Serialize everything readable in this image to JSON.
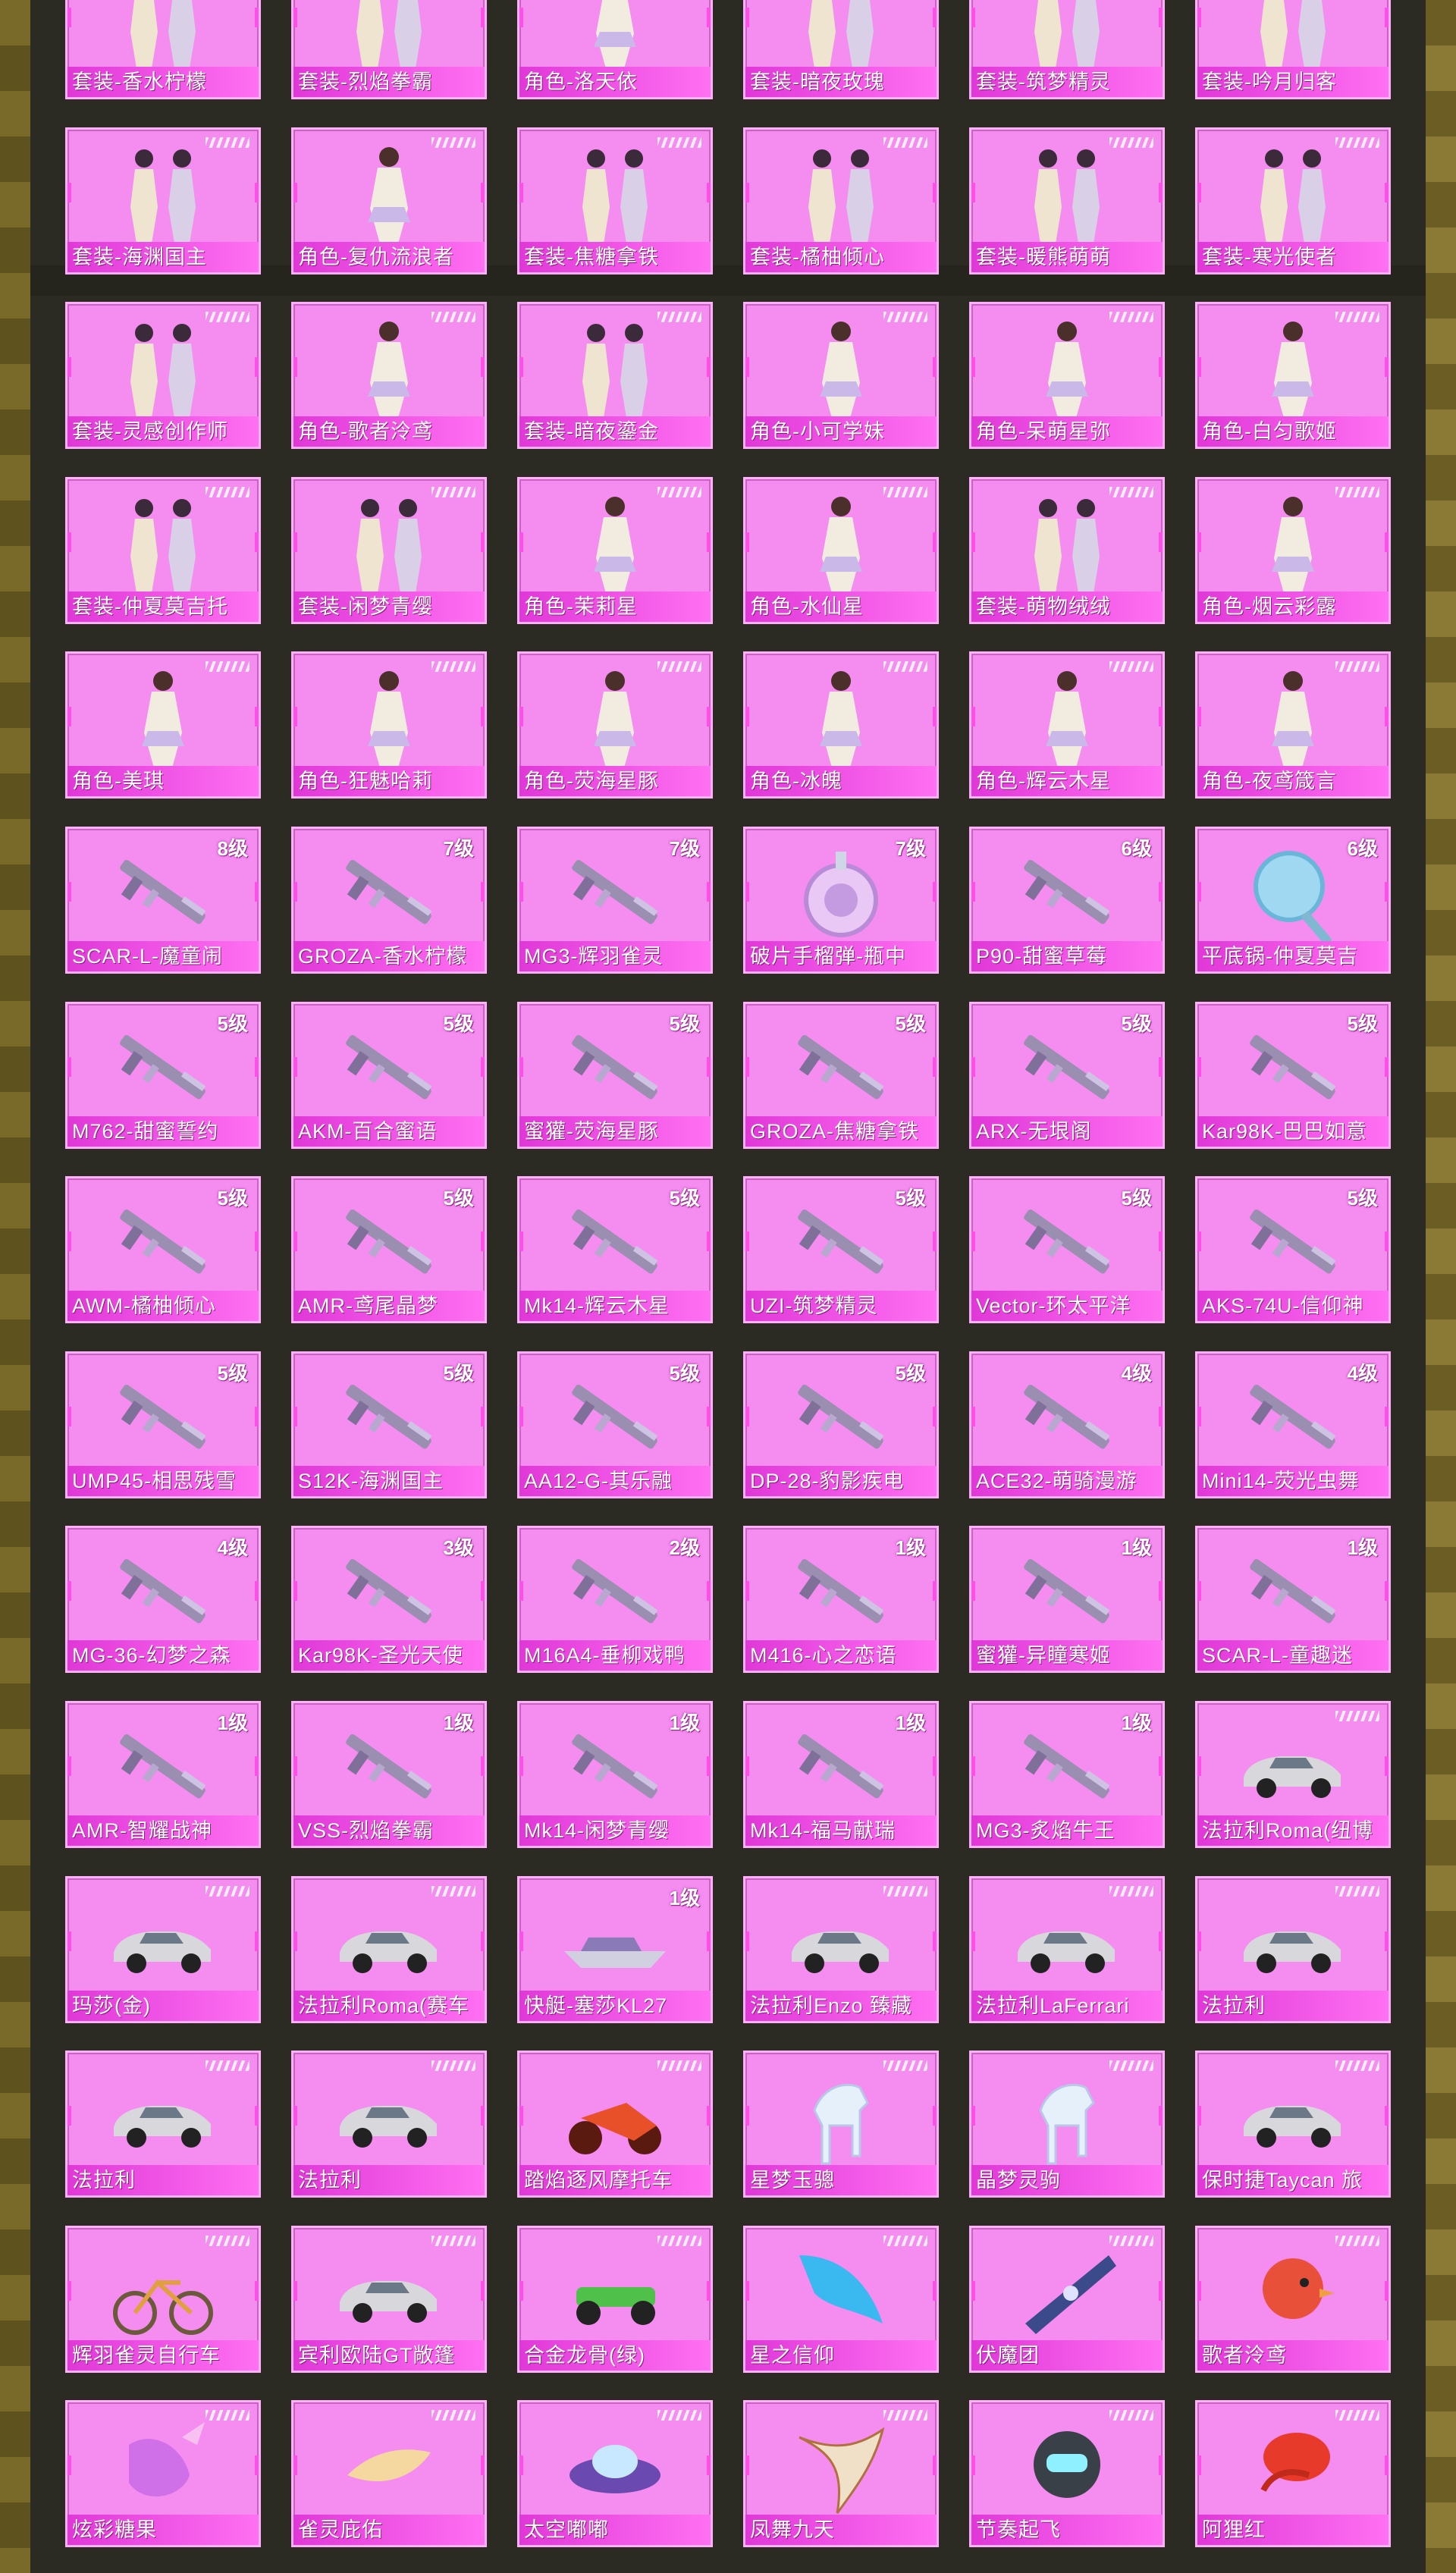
{
  "rows": [
    [
      {
        "label": "套装-香水柠檬",
        "art": "outfit-icon"
      },
      {
        "label": "套装-烈焰拳霸",
        "art": "outfit-icon"
      },
      {
        "label": "角色-洛天依",
        "art": "character-icon"
      },
      {
        "label": "套装-暗夜玫瑰",
        "art": "outfit-icon"
      },
      {
        "label": "套装-筑梦精灵",
        "art": "outfit-icon"
      },
      {
        "label": "套装-吟月归客",
        "art": "outfit-icon"
      }
    ],
    [
      {
        "label": "套装-海渊国主",
        "art": "outfit-icon"
      },
      {
        "label": "角色-复仇流浪者",
        "art": "character-icon"
      },
      {
        "label": "套装-焦糖拿铁",
        "art": "outfit-icon"
      },
      {
        "label": "套装-橘柚倾心",
        "art": "outfit-icon"
      },
      {
        "label": "套装-暖熊萌萌",
        "art": "outfit-icon"
      },
      {
        "label": "套装-寒光使者",
        "art": "outfit-icon"
      }
    ],
    [
      {
        "label": "套装-灵感创作师",
        "art": "outfit-icon"
      },
      {
        "label": "角色-歌者泠鸢",
        "art": "character-icon"
      },
      {
        "label": "套装-暗夜鎏金",
        "art": "outfit-icon"
      },
      {
        "label": "角色-小可学妹",
        "art": "character-icon"
      },
      {
        "label": "角色-呆萌星弥",
        "art": "character-icon"
      },
      {
        "label": "角色-白匀歌姬",
        "art": "character-icon"
      }
    ],
    [
      {
        "label": "套装-仲夏莫吉托",
        "art": "outfit-icon"
      },
      {
        "label": "套装-闲梦青缨",
        "art": "outfit-icon"
      },
      {
        "label": "角色-茉莉星",
        "art": "character-icon"
      },
      {
        "label": "角色-水仙星",
        "art": "character-icon"
      },
      {
        "label": "套装-萌物绒绒",
        "art": "outfit-icon"
      },
      {
        "label": "角色-烟云彩露",
        "art": "character-icon"
      }
    ],
    [
      {
        "label": "角色-美琪",
        "art": "character-icon"
      },
      {
        "label": "角色-狂魅哈莉",
        "art": "character-icon"
      },
      {
        "label": "角色-荧海星豚",
        "art": "character-icon"
      },
      {
        "label": "角色-冰魄",
        "art": "character-icon"
      },
      {
        "label": "角色-辉云木星",
        "art": "character-icon"
      },
      {
        "label": "角色-夜鸢箴言",
        "art": "character-icon"
      }
    ],
    [
      {
        "label": "SCAR-L-魔童闹",
        "level": "8级",
        "art": "gun-icon"
      },
      {
        "label": "GROZA-香水柠檬",
        "level": "7级",
        "art": "gun-icon"
      },
      {
        "label": "MG3-辉羽雀灵",
        "level": "7级",
        "art": "gun-icon"
      },
      {
        "label": "破片手榴弹-瓶中",
        "level": "7级",
        "art": "grenade-icon"
      },
      {
        "label": "P90-甜蜜草莓",
        "level": "6级",
        "art": "gun-icon"
      },
      {
        "label": "平底锅-仲夏莫吉",
        "level": "6级",
        "art": "pan-icon"
      }
    ],
    [
      {
        "label": "M762-甜蜜誓约",
        "level": "5级",
        "art": "gun-icon"
      },
      {
        "label": "AKM-百合蜜语",
        "level": "5级",
        "art": "gun-icon"
      },
      {
        "label": "蜜獾-荧海星豚",
        "level": "5级",
        "art": "gun-icon"
      },
      {
        "label": "GROZA-焦糖拿铁",
        "level": "5级",
        "art": "gun-icon"
      },
      {
        "label": "ARX-无垠阁",
        "level": "5级",
        "art": "gun-icon"
      },
      {
        "label": "Kar98K-巴巴如意",
        "level": "5级",
        "art": "gun-icon"
      }
    ],
    [
      {
        "label": "AWM-橘柚倾心",
        "level": "5级",
        "art": "gun-icon"
      },
      {
        "label": "AMR-鸢尾晶梦",
        "level": "5级",
        "art": "gun-icon"
      },
      {
        "label": "Mk14-辉云木星",
        "level": "5级",
        "art": "gun-icon"
      },
      {
        "label": "UZI-筑梦精灵",
        "level": "5级",
        "art": "gun-icon"
      },
      {
        "label": "Vector-环太平洋",
        "level": "5级",
        "art": "gun-icon"
      },
      {
        "label": "AKS-74U-信仰神",
        "level": "5级",
        "art": "gun-icon"
      }
    ],
    [
      {
        "label": "UMP45-相思残雪",
        "level": "5级",
        "art": "gun-icon"
      },
      {
        "label": "S12K-海渊国主",
        "level": "5级",
        "art": "gun-icon"
      },
      {
        "label": "AA12-G-其乐融",
        "level": "5级",
        "art": "gun-icon"
      },
      {
        "label": "DP-28-豹影疾电",
        "level": "5级",
        "art": "gun-icon"
      },
      {
        "label": "ACE32-萌骑漫游",
        "level": "4级",
        "art": "gun-icon"
      },
      {
        "label": "Mini14-荧光虫舞",
        "level": "4级",
        "art": "gun-icon"
      }
    ],
    [
      {
        "label": "MG-36-幻梦之森",
        "level": "4级",
        "art": "gun-icon"
      },
      {
        "label": "Kar98K-圣光天使",
        "level": "3级",
        "art": "gun-icon"
      },
      {
        "label": "M16A4-垂柳戏鸭",
        "level": "2级",
        "art": "gun-icon"
      },
      {
        "label": "M416-心之恋语",
        "level": "1级",
        "art": "gun-icon"
      },
      {
        "label": "蜜獾-异瞳寒姬",
        "level": "1级",
        "art": "gun-icon"
      },
      {
        "label": "SCAR-L-童趣迷",
        "level": "1级",
        "art": "gun-icon"
      }
    ],
    [
      {
        "label": "AMR-智耀战神",
        "level": "1级",
        "art": "gun-icon"
      },
      {
        "label": "VSS-烈焰拳霸",
        "level": "1级",
        "art": "gun-icon"
      },
      {
        "label": "Mk14-闲梦青缨",
        "level": "1级",
        "art": "gun-icon"
      },
      {
        "label": "Mk14-福马献瑞",
        "level": "1级",
        "art": "gun-icon"
      },
      {
        "label": "MG3-炙焰牛王",
        "level": "1级",
        "art": "gun-icon"
      },
      {
        "label": "法拉利Roma(纽博",
        "art": "car-icon"
      }
    ],
    [
      {
        "label": "玛莎(金)",
        "art": "car-icon"
      },
      {
        "label": "法拉利Roma(赛车",
        "art": "car-icon"
      },
      {
        "label": "快艇-塞莎KL27",
        "level": "1级",
        "art": "boat-icon"
      },
      {
        "label": "法拉利Enzo 臻藏",
        "art": "car-icon"
      },
      {
        "label": "法拉利LaFerrari",
        "art": "car-icon"
      },
      {
        "label": "法拉利",
        "art": "car-icon"
      }
    ],
    [
      {
        "label": "法拉利",
        "art": "car-icon"
      },
      {
        "label": "法拉利",
        "art": "car-icon"
      },
      {
        "label": "踏焰逐风摩托车",
        "art": "motorbike-icon"
      },
      {
        "label": "星梦玉骢",
        "art": "horse-icon"
      },
      {
        "label": "晶梦灵驹",
        "art": "horse-icon"
      },
      {
        "label": "保时捷Taycan 旅",
        "art": "car-icon"
      }
    ],
    [
      {
        "label": "辉羽雀灵自行车",
        "art": "bicycle-icon"
      },
      {
        "label": "宾利欧陆GT敞篷",
        "art": "car-icon"
      },
      {
        "label": "合金龙骨(绿)",
        "art": "buggy-icon"
      },
      {
        "label": "星之信仰",
        "art": "wings-icon"
      },
      {
        "label": "伏魔团",
        "art": "glider-icon"
      },
      {
        "label": "歌者泠鸢",
        "art": "chick-icon"
      }
    ],
    [
      {
        "label": "炫彩糖果",
        "art": "candy-icon"
      },
      {
        "label": "雀灵庇佑",
        "art": "feather-icon"
      },
      {
        "label": "太空嘟嘟",
        "art": "ufo-icon"
      },
      {
        "label": "凤舞九天",
        "art": "phoenix-icon"
      },
      {
        "label": "节奏起飞",
        "art": "robot-icon"
      },
      {
        "label": "阿狸红",
        "art": "balloon-icon"
      }
    ]
  ],
  "colors": {
    "card": "#f58cf0",
    "label_bar": "#e038d8",
    "text": "#ffffff"
  }
}
